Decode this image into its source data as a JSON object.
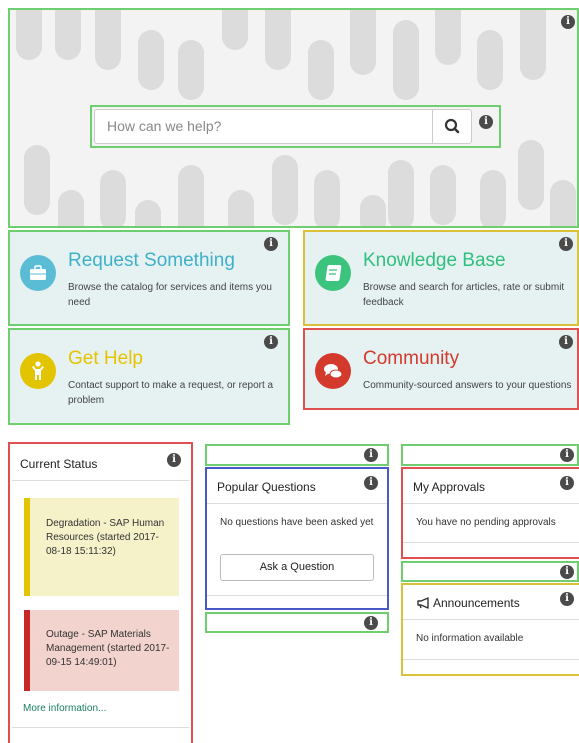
{
  "search": {
    "placeholder": "How can we help?"
  },
  "tiles": [
    {
      "title": "Request Something",
      "description": "Browse the catalog for services and items you need",
      "title_color": "#3fb0c8",
      "icon_color": "#5bbcd6"
    },
    {
      "title": "Knowledge Base",
      "description": "Browse and search for articles, rate or submit feedback",
      "title_color": "#2fbf7f",
      "icon_color": "#3cc47f"
    },
    {
      "title": "Get Help",
      "description": "Contact support to make a request, or report a problem",
      "title_color": "#e6c200",
      "icon_color": "#e3c400"
    },
    {
      "title": "Community",
      "description": "Community-sourced answers to your questions",
      "title_color": "#d33a2c",
      "icon_color": "#d33a2c"
    }
  ],
  "current_status": {
    "title": "Current Status",
    "items": [
      {
        "text": "Degradation - SAP Human Resources (started 2017-08-18 15:11:32)",
        "bar_color": "#e3c400",
        "bg_color": "#f5f1c9"
      },
      {
        "text": "Outage - SAP Materials Management (started 2017-09-15 14:49:01)",
        "bar_color": "#c62828",
        "bg_color": "#f2d3cd"
      }
    ],
    "more_link": "More information..."
  },
  "popular_questions": {
    "title": "Popular Questions",
    "empty_text": "No questions have been asked yet",
    "button": "Ask a Question"
  },
  "approvals": {
    "title": "My Approvals",
    "empty_text": "You have no pending approvals"
  },
  "announcements": {
    "title": "Announcements",
    "empty_text": "No information available"
  },
  "icons": {
    "info": "info-icon",
    "search": "search-icon",
    "megaphone": "megaphone-icon"
  },
  "colors": {
    "outline_green": "#6fcf6f",
    "outline_red": "#e05050",
    "outline_blue": "#4a59c8",
    "outline_yellow": "#d9c23a"
  }
}
